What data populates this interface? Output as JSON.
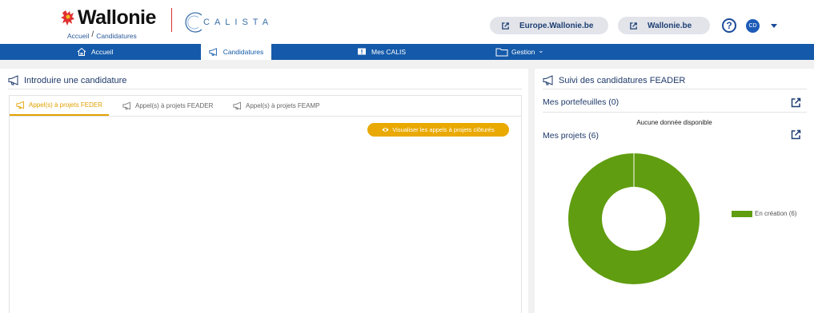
{
  "header": {
    "logo_text": "Wallonie",
    "app_name": "CALISTA",
    "breadcrumb": [
      "Accueil",
      "Candidatures"
    ],
    "external_links": [
      "Europe.Wallonie.be",
      "Wallonie.be"
    ],
    "help_label": "?",
    "user_initials": "CD"
  },
  "nav": {
    "items": [
      {
        "label": "Accueil",
        "icon": "home-icon"
      },
      {
        "label": "Candidatures",
        "icon": "megaphone-icon",
        "active": true
      },
      {
        "label": "Mes CALIS",
        "icon": "message-icon"
      },
      {
        "label": "Gestion",
        "icon": "folder-icon",
        "caret": "⌄"
      }
    ]
  },
  "left_panel": {
    "title": "Introduire une candidature",
    "tabs": [
      {
        "label": "Appel(s) à projets FEDER",
        "active": true
      },
      {
        "label": "Appel(s) à projets FEADER"
      },
      {
        "label": "Appel(s) à projets FEAMP"
      }
    ],
    "closed_button": "Visualiser les appels à projets clôturés"
  },
  "right_panel": {
    "title": "Suivi des candidatures FEADER",
    "portefeuilles_label": "Mes portefeuilles (0)",
    "no_data": "Aucune donnée disponible",
    "projets_label": "Mes projets (6)",
    "legend_label": "En création (6)"
  },
  "chart_data": {
    "type": "pie",
    "categories": [
      "En création"
    ],
    "values": [
      6
    ],
    "colors": [
      "#609d10"
    ],
    "legend_position": "right"
  },
  "colors": {
    "nav_blue": "#155aaa",
    "accent_orange": "#e9a900",
    "chart_green": "#609d10"
  }
}
